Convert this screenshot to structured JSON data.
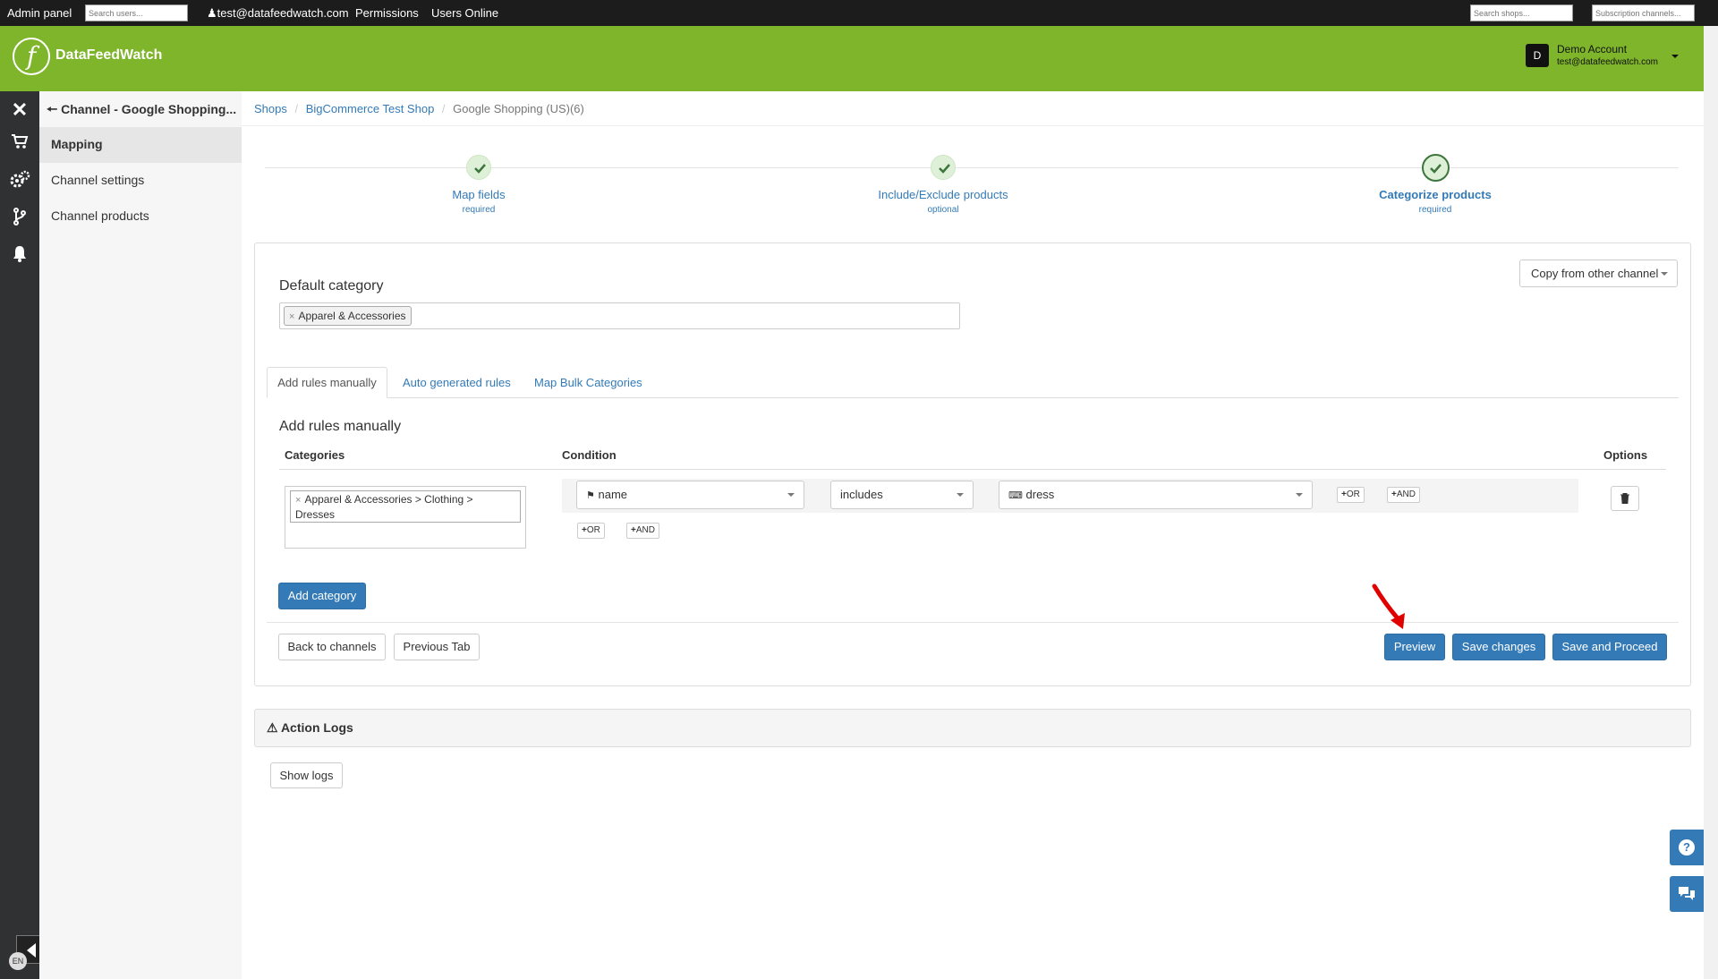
{
  "admin_bar": {
    "admin_panel": "Admin panel",
    "search_users_placeholder": "Search users...",
    "user_email": "test@datafeedwatch.com",
    "permissions": "Permissions",
    "users_online": "Users Online",
    "search_shops_placeholder": "Search shops...",
    "subscription_channels_placeholder": "Subscription channels..."
  },
  "header": {
    "brand": "DataFeedWatch",
    "account_initial": "D",
    "account_name": "Demo Account",
    "account_email": "test@datafeedwatch.com"
  },
  "sidebar": {
    "title": "Channel - Google Shopping...",
    "items": [
      {
        "label": "Mapping",
        "active": true
      },
      {
        "label": "Channel settings",
        "active": false
      },
      {
        "label": "Channel products",
        "active": false
      }
    ],
    "icons": [
      "close-icon",
      "cart-icon",
      "gears-icon",
      "branch-icon",
      "bell-icon"
    ],
    "language": "EN"
  },
  "breadcrumb": {
    "items": [
      "Shops",
      "BigCommerce Test Shop",
      "Google Shopping (US)(6)"
    ]
  },
  "steps": [
    {
      "title": "Map fields",
      "subtitle": "required"
    },
    {
      "title": "Include/Exclude products",
      "subtitle": "optional"
    },
    {
      "title": "Categorize products",
      "subtitle": "required"
    }
  ],
  "copy_dropdown": "Copy from other channel",
  "default_category": {
    "label": "Default category",
    "tag": "Apparel & Accessories",
    "remove": "×"
  },
  "tabs": [
    "Add rules manually",
    "Auto generated rules",
    "Map Bulk Categories"
  ],
  "rules": {
    "heading": "Add rules manually",
    "col_categories": "Categories",
    "col_condition": "Condition",
    "col_options": "Options",
    "category_tag_line1": "Apparel & Accessories > Clothing >",
    "category_tag_line2": "Dresses",
    "field": "name",
    "operator": "includes",
    "value": "dress",
    "or_label": "OR",
    "and_label": "AND",
    "plus": "+"
  },
  "buttons": {
    "add_category": "Add category",
    "back_to_channels": "Back to channels",
    "previous_tab": "Previous Tab",
    "preview": "Preview",
    "save_changes": "Save changes",
    "save_and_proceed": "Save and Proceed"
  },
  "action_logs": {
    "title": "Action Logs",
    "show_logs": "Show logs"
  },
  "colors": {
    "brand_green": "#7eb52b",
    "primary_blue": "#337ab7",
    "dark_sidebar": "#2f3133",
    "admin_bar": "#1c1c1c",
    "arrow_red": "#e00000"
  }
}
